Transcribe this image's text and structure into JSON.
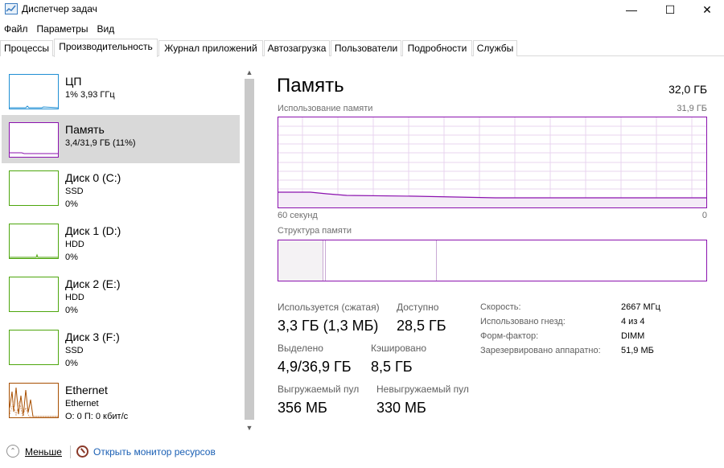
{
  "window": {
    "title": "Диспетчер задач",
    "minimize": "—",
    "maximize": "☐",
    "close": "✕"
  },
  "menu": [
    "Файл",
    "Параметры",
    "Вид"
  ],
  "tabs": [
    {
      "label": "Процессы",
      "active": false
    },
    {
      "label": "Производительность",
      "active": true
    },
    {
      "label": "Журнал приложений",
      "active": false
    },
    {
      "label": "Автозагрузка",
      "active": false
    },
    {
      "label": "Пользователи",
      "active": false
    },
    {
      "label": "Подробности",
      "active": false
    },
    {
      "label": "Службы",
      "active": false
    }
  ],
  "sidebar": {
    "items": [
      {
        "title": "ЦП",
        "sub1": "1% 3,93 ГГц",
        "sub2": "",
        "color": "#1f8fd4",
        "selected": false
      },
      {
        "title": "Память",
        "sub1": "3,4/31,9 ГБ (11%)",
        "sub2": "",
        "color": "#8b12ae",
        "selected": true
      },
      {
        "title": "Диск 0 (C:)",
        "sub1": "SSD",
        "sub2": "0%",
        "color": "#4da60c",
        "selected": false
      },
      {
        "title": "Диск 1 (D:)",
        "sub1": "HDD",
        "sub2": "0%",
        "color": "#4da60c",
        "selected": false
      },
      {
        "title": "Диск 2 (E:)",
        "sub1": "HDD",
        "sub2": "0%",
        "color": "#4da60c",
        "selected": false
      },
      {
        "title": "Диск 3 (F:)",
        "sub1": "SSD",
        "sub2": "0%",
        "color": "#4da60c",
        "selected": false
      },
      {
        "title": "Ethernet",
        "sub1": "Ethernet",
        "sub2": "О: 0 П: 0 кбит/с",
        "color": "#a74f01",
        "selected": false
      }
    ],
    "scroll_up": "▲",
    "scroll_down": "▼"
  },
  "main": {
    "title": "Память",
    "total": "32,0 ГБ",
    "usage_label": "Использование памяти",
    "usage_max": "31,9 ГБ",
    "axis_left": "60 секунд",
    "axis_right": "0",
    "structure_label": "Структура памяти",
    "stats": {
      "in_use_label": "Используется (сжатая)",
      "in_use_value": "3,3 ГБ (1,3 МБ)",
      "available_label": "Доступно",
      "available_value": "28,5 ГБ",
      "committed_label": "Выделено",
      "committed_value": "4,9/36,9 ГБ",
      "cached_label": "Кэшировано",
      "cached_value": "8,5 ГБ",
      "paged_label": "Выгружаемый пул",
      "paged_value": "356 МБ",
      "nonpaged_label": "Невыгружаемый пул",
      "nonpaged_value": "330 МБ"
    },
    "specs": [
      {
        "label": "Скорость:",
        "value": "2667 МГц"
      },
      {
        "label": "Использовано гнезд:",
        "value": "4 из 4"
      },
      {
        "label": "Форм-фактор:",
        "value": "DIMM"
      },
      {
        "label": "Зарезервировано аппаратно:",
        "value": "51,9 МБ"
      }
    ]
  },
  "footer": {
    "fewer": "Меньше",
    "fewer_icon": "⌃",
    "monitor_link": "Открыть монитор ресурсов"
  },
  "colors": {
    "memory": "#8b12ae",
    "cpu": "#1f8fd4",
    "disk": "#4da60c",
    "ethernet": "#a74f01",
    "link": "#1a5fb4"
  }
}
